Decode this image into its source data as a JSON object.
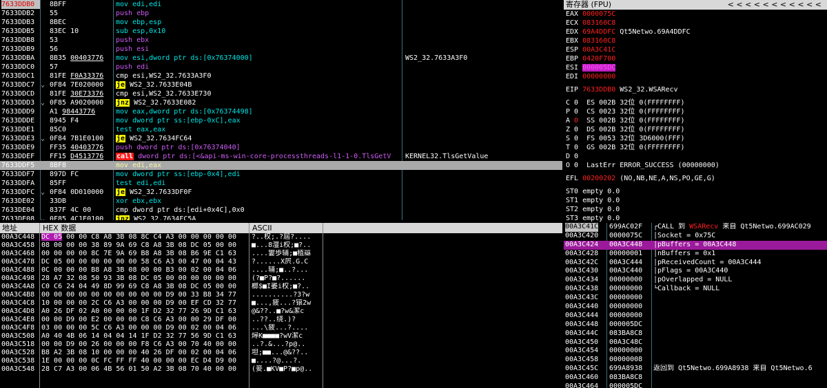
{
  "disasm": [
    {
      "addr": "7633DDB0",
      "jmp": "",
      "hex": "8BFF",
      "op": "mov",
      "args": "edi,edi",
      "cmt": "",
      "cur": true
    },
    {
      "addr": "7633DDB2",
      "jmp": "",
      "hex": "55",
      "op": "push",
      "args": "ebp",
      "cmt": ""
    },
    {
      "addr": "7633DDB3",
      "jmp": "",
      "hex": "8BEC",
      "op": "mov",
      "args": "ebp,esp",
      "cmt": ""
    },
    {
      "addr": "7633DDB5",
      "jmp": "",
      "hex": "83EC 10",
      "op": "sub",
      "args": "esp,0x10",
      "cmt": ""
    },
    {
      "addr": "7633DDB8",
      "jmp": "",
      "hex": "53",
      "op": "push",
      "args": "ebx",
      "cmt": ""
    },
    {
      "addr": "7633DDB9",
      "jmp": "",
      "hex": "56",
      "op": "push",
      "args": "esi",
      "cmt": ""
    },
    {
      "addr": "7633DDBA",
      "jmp": "",
      "hex": "8B35 00403776",
      "op": "mov",
      "args": "esi,dword ptr ds:[0x76374000]",
      "cmt": "WS2_32.7633A3F0"
    },
    {
      "addr": "7633DDC0",
      "jmp": "",
      "hex": "57",
      "op": "push",
      "args": "edi",
      "cmt": ""
    },
    {
      "addr": "7633DDC1",
      "jmp": "",
      "hex": "81FE F0A33376",
      "op": "cmp",
      "args": "esi,WS2_32.7633A3F0",
      "cmt": ""
    },
    {
      "addr": "7633DDC7",
      "jmp": "⌄",
      "hex": "0F84 7E020000",
      "op": "je",
      "args": "WS2_32.7633E04B",
      "cmt": ""
    },
    {
      "addr": "7633DDCD",
      "jmp": "",
      "hex": "81FE 30E73376",
      "op": "cmp",
      "args": "esi,WS2_32.7633E730",
      "cmt": ""
    },
    {
      "addr": "7633DDD3",
      "jmp": "⌄",
      "hex": "0F85 A9020000",
      "op": "jnz",
      "args": "WS2_32.7633E082",
      "cmt": ""
    },
    {
      "addr": "7633DDD9",
      "jmp": "",
      "hex": "A1 98443776",
      "op": "mov",
      "args": "eax,dword ptr ds:[0x76374498]",
      "cmt": ""
    },
    {
      "addr": "7633DDDE",
      "jmp": "",
      "hex": "8945 F4",
      "op": "mov",
      "args": "dword ptr ss:[ebp-0xC],eax",
      "cmt": ""
    },
    {
      "addr": "7633DDE1",
      "jmp": "",
      "hex": "85C0",
      "op": "test",
      "args": "eax,eax",
      "cmt": ""
    },
    {
      "addr": "7633DDE3",
      "jmp": "⌄",
      "hex": "0F84 7B1E0100",
      "op": "je",
      "args": "WS2_32.7634FC64",
      "cmt": ""
    },
    {
      "addr": "7633DDE9",
      "jmp": "",
      "hex": "FF35 40403776",
      "op": "push",
      "args": "dword ptr ds:[0x76374040]",
      "cmt": ""
    },
    {
      "addr": "7633DDEF",
      "jmp": "",
      "hex": "FF15 D4513776",
      "op": "call",
      "args": "dword ptr ds:[<&api-ms-win-core-processthreads-l1-1-0.TlsGetV",
      "cmt": "KERNEL32.TlsGetValue"
    },
    {
      "addr": "7633DDF5",
      "jmp": "",
      "hex": "8BF8",
      "op": "mov",
      "args": "edi,eax",
      "cmt": "",
      "sel": true
    },
    {
      "addr": "7633DDF7",
      "jmp": "",
      "hex": "897D FC",
      "op": "mov",
      "args": "dword ptr ss:[ebp-0x4],edi",
      "cmt": ""
    },
    {
      "addr": "7633DDFA",
      "jmp": "",
      "hex": "85FF",
      "op": "test",
      "args": "edi,edi",
      "cmt": ""
    },
    {
      "addr": "7633DDFC",
      "jmp": "⌄",
      "hex": "0F84 0D010000",
      "op": "je",
      "args": "WS2_32.7633DF0F",
      "cmt": ""
    },
    {
      "addr": "7633DE02",
      "jmp": "",
      "hex": "33DB",
      "op": "xor",
      "args": "ebx,ebx",
      "cmt": ""
    },
    {
      "addr": "7633DE04",
      "jmp": "",
      "hex": "837F 4C 00",
      "op": "cmp",
      "args": "dword ptr ds:[edi+0x4C],0x0",
      "cmt": ""
    },
    {
      "addr": "7633DE08",
      "jmp": "⌄",
      "hex": "0F85 4C1E0100",
      "op": "jnz",
      "args": "WS2_32.7634FC5A",
      "cmt": ""
    }
  ],
  "regs": {
    "title": "寄存器 (FPU)",
    "arrows": "< < < < < < < < < < <",
    "rows": [
      {
        "name": "EAX",
        "val": "0000075C",
        "extra": "",
        "style": "red"
      },
      {
        "name": "ECX",
        "val": "083160C8",
        "extra": "",
        "style": "red"
      },
      {
        "name": "EDX",
        "val": "69A4DDFC",
        "extra": " Qt5Netwo.69A4DDFC",
        "style": "red"
      },
      {
        "name": "EBX",
        "val": "083160C8",
        "extra": "",
        "style": "red"
      },
      {
        "name": "ESP",
        "val": "00A3C41C",
        "extra": "",
        "style": "red"
      },
      {
        "name": "EBP",
        "val": "0420F700",
        "extra": "",
        "style": "red"
      },
      {
        "name": "ESI",
        "val": "000005DC",
        "extra": "",
        "style": "hi"
      },
      {
        "name": "EDI",
        "val": "00000000",
        "extra": "",
        "style": "red"
      },
      {
        "gap": true
      },
      {
        "name": "EIP",
        "val": "7633DDB0",
        "extra": " WS2_32.WSARecv",
        "style": "red"
      },
      {
        "gap": true
      },
      {
        "text": "C 0  ES 002B 32位 0(FFFFFFFF)"
      },
      {
        "text": "P 0  CS 0023 32位 0(FFFFFFFF)"
      },
      {
        "text": "A 0  SS 002B 32位 0(FFFFFFFF)",
        "redA": true
      },
      {
        "text": "Z 0  DS 002B 32位 0(FFFFFFFF)"
      },
      {
        "text": "S 0  FS 0053 32位 3D6000(FFF)"
      },
      {
        "text": "T 0  GS 002B 32位 0(FFFFFFFF)"
      },
      {
        "text": "D 0"
      },
      {
        "text": "O 0  LastErr ERROR_SUCCESS (00000000)"
      },
      {
        "gap": true
      },
      {
        "name": "EFL",
        "val": "00200202",
        "extra": " (NO,NB,NE,A,NS,PO,GE,G)",
        "style": "red"
      },
      {
        "gap": true
      },
      {
        "text": "ST0 empty 0.0"
      },
      {
        "text": "ST1 empty 0.0"
      },
      {
        "text": "ST2 empty 0.0"
      },
      {
        "text": "ST3 empty 0.0"
      }
    ]
  },
  "dump": {
    "col_addr": "地址",
    "col_hex": "HEX 数据",
    "col_ascii": "ASCII",
    "rows": [
      {
        "addr": "00A3C448",
        "hex": "DC 05 00 00 C8 A8 3B 08 8C C4 A3 00 00 00 00 00",
        "ascii": "?..权;.?屆?...."
      },
      {
        "addr": "00A3C458",
        "hex": "08 00 00 00 38 89 9A 69 C8 A8 3B 08 DC 05 00 00",
        "ascii": "■...8澶i权;■?.."
      },
      {
        "addr": "00A3C468",
        "hex": "00 00 00 00 8C 7E 9A 69 B8 A8 3B 08 B6 9E C1 63",
        "ascii": "....寠歩辅;■稙羉"
      },
      {
        "addr": "00A3C478",
        "hex": "DC 05 00 00 00 00 00 00 58 C6 A3 00 47 00 04 43",
        "ascii": "?......X屄.G.C"
      },
      {
        "addr": "00A3C488",
        "hex": "0C 00 00 00 B8 A8 3B 08 00 00 B3 00 02 00 04 06",
        "ascii": "....辅;■..?..."
      },
      {
        "addr": "00A3C498",
        "hex": "28 A7 32 08 50 93 3B 08 DC 05 00 00 00 00 00 00",
        "ascii": "(?■P?■?......"
      },
      {
        "addr": "00A3C4A8",
        "hex": "C0 C6 24 04 49 8D 99 69 C8 A8 3B 08 DC 05 00 00",
        "ascii": "榔$■I崣i权;■?.."
      },
      {
        "addr": "00A3C4B8",
        "hex": "00 00 00 00 00 00 00 00 00 00 D9 00 33 B8 34 77",
        "ascii": "..........?3?w"
      },
      {
        "addr": "00A3C4C8",
        "hex": "10 00 00 00 2C C6 A3 00 00 00 D9 00 EF CD 32 77",
        "ascii": "■...,疲...?锿2w"
      },
      {
        "addr": "00A3C4D8",
        "hex": "A0 26 DF 02 A0 00 00 00 1F D2 32 77 26 9D C1 63",
        "ascii": "@&??..■?w&潔c"
      },
      {
        "addr": "00A3C4E8",
        "hex": "00 00 D9 00 E2 00 00 00 C8 C6 A3 00 00 29 DF 00",
        "ascii": "..??..绕.)?"
      },
      {
        "addr": "00A3C4F8",
        "hex": "03 00 00 00 5C C6 A3 00 00 00 D9 00 02 00 04 06",
        "ascii": "...\\疲...?...."
      },
      {
        "addr": "00A3C508",
        "hex": "A0 40 4B 06 14 04 04 14 1F D2 32 77 56 9D C1 63",
        "ascii": "燖K■■■■?wV潔c"
      },
      {
        "addr": "00A3C518",
        "hex": "00 00 D9 00 26 00 00 00 F8 C6 A3 00 70 40 00 00",
        "ascii": "..?.&...?p@.."
      },
      {
        "addr": "00A3C528",
        "hex": "B8 A2 3B 08 10 00 00 00 40 26 DF 00 02 00 04 06",
        "ascii": "坦;■■...@&??.."
      },
      {
        "addr": "00A3C538",
        "hex": "1E 00 00 00 0C FC FF FF 40 00 00 00 EC D4 D9 00",
        "ascii": "■....?@...?."
      },
      {
        "addr": "00A3C548",
        "hex": "28 C7 A3 00 06 4B 56 01 50 A2 3B 08 70 40 00 00",
        "ascii": "(妾.■KV■P?■p@.."
      }
    ]
  },
  "stack": {
    "rows": [
      {
        "addr": "00A3C41C",
        "val": "699AC02F",
        "cmt": "┌CALL 到 WSARecv 来自 Qt5Netwo.699AC029",
        "top": true,
        "fn": "WSARecv"
      },
      {
        "addr": "00A3C420",
        "val": "0000075C",
        "cmt": "│Socket = 0x75C"
      },
      {
        "addr": "00A3C424",
        "val": "00A3C448",
        "cmt": "│pBuffers = 00A3C448",
        "sel": true
      },
      {
        "addr": "00A3C428",
        "val": "00000001",
        "cmt": "│nBuffers = 0x1"
      },
      {
        "addr": "00A3C42C",
        "val": "00A3C444",
        "cmt": "│pReceivedCount = 00A3C444"
      },
      {
        "addr": "00A3C430",
        "val": "00A3C440",
        "cmt": "│pFlags = 00A3C440"
      },
      {
        "addr": "00A3C434",
        "val": "00000000",
        "cmt": "│pOverlapped = NULL"
      },
      {
        "addr": "00A3C438",
        "val": "00000000",
        "cmt": "└Callback = NULL"
      },
      {
        "addr": "00A3C43C",
        "val": "00000000",
        "cmt": ""
      },
      {
        "addr": "00A3C440",
        "val": "00000000",
        "cmt": ""
      },
      {
        "addr": "00A3C444",
        "val": "00000000",
        "cmt": ""
      },
      {
        "addr": "00A3C448",
        "val": "000005DC",
        "cmt": ""
      },
      {
        "addr": "00A3C44C",
        "val": "083BA8C8",
        "cmt": ""
      },
      {
        "addr": "00A3C450",
        "val": "00A3C48C",
        "cmt": ""
      },
      {
        "addr": "00A3C454",
        "val": "00000000",
        "cmt": ""
      },
      {
        "addr": "00A3C458",
        "val": "00000008",
        "cmt": ""
      },
      {
        "addr": "00A3C45C",
        "val": "699A8938",
        "cmt": "返回到 Qt5Netwo.699A8938 来自 Qt5Netwo.6"
      },
      {
        "addr": "00A3C460",
        "val": "083BA8C8",
        "cmt": ""
      },
      {
        "addr": "00A3C464",
        "val": "000005DC",
        "cmt": ""
      }
    ]
  }
}
